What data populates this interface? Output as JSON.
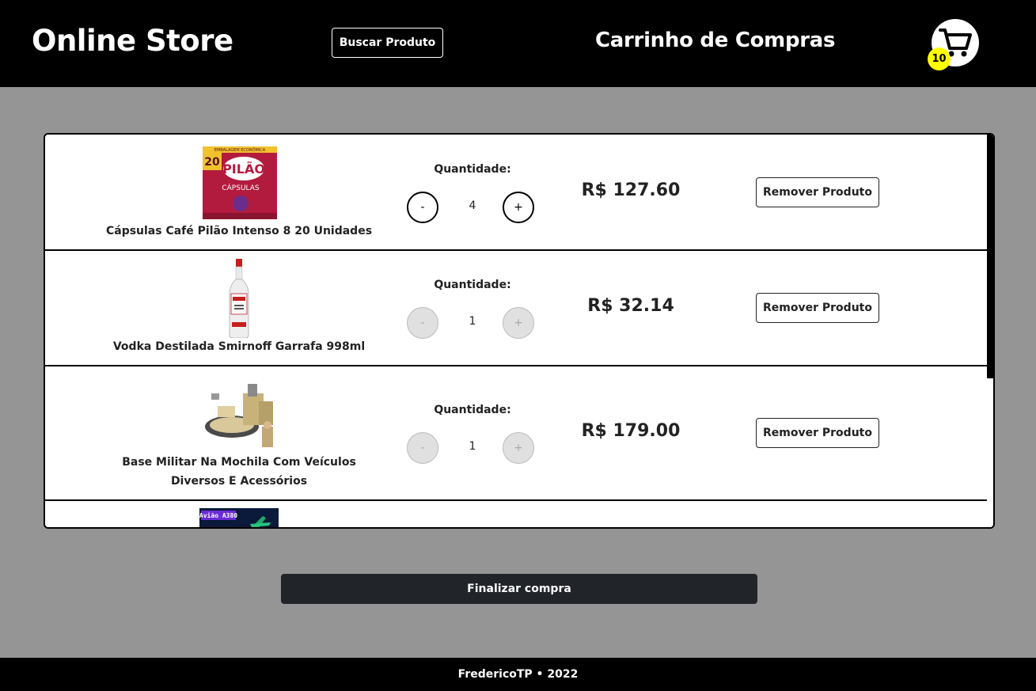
{
  "header": {
    "logo": "Online Store",
    "search_button": "Buscar Produto",
    "title": "Carrinho de Compras",
    "cart_count": "10"
  },
  "cart": {
    "quantity_label": "Quantidade:",
    "minus": "-",
    "plus": "+",
    "remove_label": "Remover Produto",
    "items": [
      {
        "name": "Cápsulas Café Pilão Intenso 8 20 Unidades",
        "quantity": "4",
        "price": "R$ 127.60"
      },
      {
        "name": "Vodka Destilada Smirnoff Garrafa 998ml",
        "quantity": "1",
        "price": "R$ 32.14"
      },
      {
        "name": "Base Militar Na Mochila Com Veículos Diversos E Acessórios",
        "quantity": "1",
        "price": "R$ 179.00"
      },
      {
        "name": "",
        "image_caption": "Avião A380"
      }
    ],
    "product_image_texts": {
      "pilao_top": "EMBALAGEM ECONÔMICA",
      "pilao_count": "20",
      "pilao_brand": "PILÃO",
      "pilao_caps": "CÁPSULAS"
    }
  },
  "checkout_button": "Finalizar compra",
  "footer": "FredericoTP • 2022",
  "colors": {
    "header_bg": "#000000",
    "page_bg": "#959595",
    "badge": "#ffff00",
    "checkout_bg": "#212529"
  },
  "icons": {
    "cart": "shopping-cart-icon"
  }
}
